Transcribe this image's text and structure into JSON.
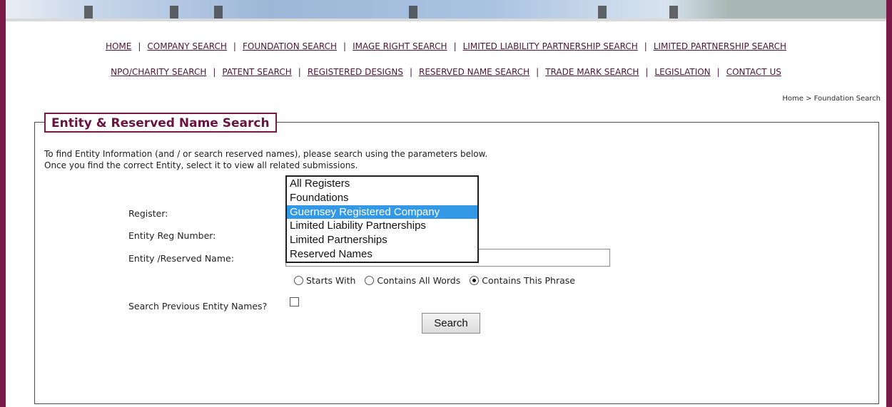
{
  "nav": {
    "row1": [
      "HOME",
      "COMPANY SEARCH",
      "FOUNDATION SEARCH",
      "IMAGE RIGHT SEARCH",
      "LIMITED LIABILITY PARTNERSHIP SEARCH",
      "LIMITED PARTNERSHIP SEARCH"
    ],
    "row2": [
      "NPO/CHARITY SEARCH",
      "PATENT SEARCH",
      "REGISTERED DESIGNS",
      "RESERVED NAME SEARCH",
      "TRADE MARK SEARCH",
      "LEGISLATION",
      "CONTACT US"
    ],
    "separator": "|"
  },
  "breadcrumb": "Home > Foundation Search",
  "panel": {
    "title": "Entity & Reserved Name Search",
    "intro_line1": "To find Entity Information (and / or search reserved names), please search using the parameters below.",
    "intro_line2": "Once you find the correct Entity, select it to view all related submissions."
  },
  "form": {
    "register_label": "Register:",
    "reg_number_label": "Entity Reg Number:",
    "name_label": "Entity /Reserved Name:",
    "name_value": "",
    "register_options": [
      "All Registers",
      "Foundations",
      "Guernsey Registered Company",
      "Limited Liability Partnerships",
      "Limited Partnerships",
      "Reserved Names"
    ],
    "register_selected": "Guernsey Registered Company",
    "match_options": [
      "Starts With",
      "Contains All Words",
      "Contains This Phrase"
    ],
    "match_selected": "Contains This Phrase",
    "previous_names_label": "Search Previous Entity Names?",
    "previous_names_checked": false,
    "search_button": "Search"
  },
  "colors": {
    "brand": "#7a1a48",
    "nav_text": "#4a1734",
    "selection": "#3399e6"
  }
}
